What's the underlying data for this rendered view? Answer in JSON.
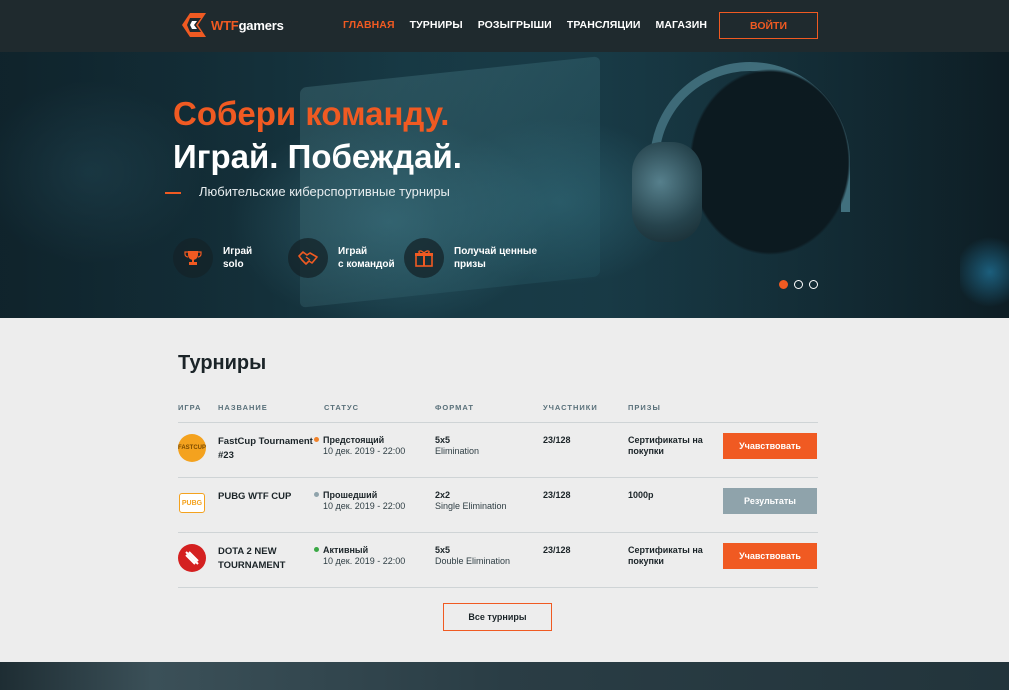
{
  "header": {
    "logo": {
      "wtf": "WTF",
      "gamers": "gamers"
    },
    "nav": [
      {
        "label": "ГЛАВНАЯ",
        "active": true
      },
      {
        "label": "ТУРНИРЫ",
        "active": false
      },
      {
        "label": "РОЗЫГРЫШИ",
        "active": false
      },
      {
        "label": "ТРАНСЛЯЦИИ",
        "active": false
      },
      {
        "label": "МАГАЗИН",
        "active": false
      }
    ],
    "login_label": "ВОЙТИ"
  },
  "hero": {
    "title_line1": "Собери команду.",
    "title_line2": "Играй. Побеждай.",
    "subtitle": "Любительские киберспортивные турниры",
    "features": [
      {
        "icon": "trophy-icon",
        "line1": "Играй",
        "line2": "solo"
      },
      {
        "icon": "handshake-icon",
        "line1": "Играй",
        "line2": "с командой"
      },
      {
        "icon": "gift-icon",
        "line1": "Получай ценные",
        "line2": "призы"
      }
    ],
    "slider": {
      "active_slide": 1,
      "total_slides": 3
    }
  },
  "tournaments": {
    "title": "Турниры",
    "columns": [
      "ИГРА",
      "НАЗВАНИЕ",
      "СТАТУС",
      "ФОРМАТ",
      "УЧАСТНИКИ",
      "ПРИЗЫ"
    ],
    "rows": [
      {
        "game_icon": "fastcup-icon",
        "game_icon_text": "FASTCUP",
        "name": "FastCup Tournament #23",
        "status": "Предстоящий",
        "status_color": "#f0822a",
        "date": "10 дек. 2019 - 22:00",
        "format": "5x5",
        "format_type": "Elimination",
        "participants": "23/128",
        "prize": "Сертификаты на покупки",
        "action": "Учавствовать",
        "action_style": "orange"
      },
      {
        "game_icon": "pubg-icon",
        "game_icon_text": "PUBG",
        "name": "PUBG WTF CUP",
        "status": "Прошедший",
        "status_color": "#8fa3ab",
        "date": "10 дек. 2019 - 22:00",
        "format": "2x2",
        "format_type": "Single Elimination",
        "participants": "23/128",
        "prize": "1000р",
        "action": "Результаты",
        "action_style": "grey"
      },
      {
        "game_icon": "dota2-icon",
        "game_icon_text": "",
        "name": "DOTA 2 NEW TOURNAMENT",
        "status": "Активный",
        "status_color": "#3aa845",
        "date": "10 дек. 2019 - 22:00",
        "format": "5x5",
        "format_type": "Double Elimination",
        "participants": "23/128",
        "prize": "Сертификаты на покупки",
        "action": "Учавствовать",
        "action_style": "orange"
      }
    ],
    "all_label": "Все турниры"
  },
  "colors": {
    "accent": "#f05a22",
    "header_bg": "#1f2a2e",
    "page_bg": "#ededed",
    "muted_button": "#8fa3ab"
  }
}
